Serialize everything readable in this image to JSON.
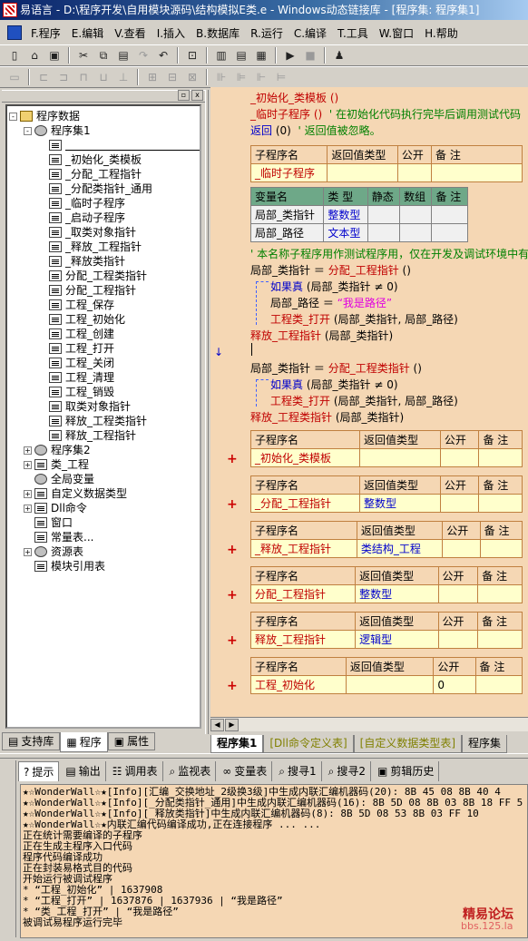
{
  "window": {
    "title": "易语言 - D:\\程序开发\\自用模块源码\\结构模拟E类.e - Windows动态链接库 - [程序集: 程序集1]"
  },
  "menu": {
    "items": [
      "F.程序",
      "E.编辑",
      "V.查看",
      "I.插入",
      "B.数据库",
      "R.运行",
      "C.编译",
      "T.工具",
      "W.窗口",
      "H.帮助"
    ]
  },
  "toolbar1": {
    "icons": [
      "new-icon",
      "open-icon",
      "save-icon",
      "cut-icon",
      "copy-icon",
      "paste-icon",
      "redo-icon",
      "undo-icon",
      "find-icon",
      "layout1-icon",
      "layout2-icon",
      "layout3-icon",
      "run-icon",
      "stop-icon",
      "debug-icon"
    ]
  },
  "left": {
    "tree": [
      {
        "label": "程序数据",
        "indent": 0,
        "pm": "-",
        "icon": "folder"
      },
      {
        "label": "程序集1",
        "indent": 1,
        "pm": "-",
        "icon": "gear"
      },
      {
        "label": "",
        "indent": 2,
        "pm": "",
        "icon": "doc",
        "underline": true
      },
      {
        "label": "_初始化_类模板",
        "indent": 2,
        "pm": "",
        "icon": "doc"
      },
      {
        "label": "_分配_工程指针",
        "indent": 2,
        "pm": "",
        "icon": "doc"
      },
      {
        "label": "_分配类指针_通用",
        "indent": 2,
        "pm": "",
        "icon": "doc"
      },
      {
        "label": "_临时子程序",
        "indent": 2,
        "pm": "",
        "icon": "doc"
      },
      {
        "label": "_启动子程序",
        "indent": 2,
        "pm": "",
        "icon": "doc"
      },
      {
        "label": "_取类对象指针",
        "indent": 2,
        "pm": "",
        "icon": "doc"
      },
      {
        "label": "_释放_工程指针",
        "indent": 2,
        "pm": "",
        "icon": "doc"
      },
      {
        "label": "_释放类指针",
        "indent": 2,
        "pm": "",
        "icon": "doc"
      },
      {
        "label": "分配_工程类指针",
        "indent": 2,
        "pm": "",
        "icon": "doc"
      },
      {
        "label": "分配_工程指针",
        "indent": 2,
        "pm": "",
        "icon": "doc"
      },
      {
        "label": "工程_保存",
        "indent": 2,
        "pm": "",
        "icon": "doc"
      },
      {
        "label": "工程_初始化",
        "indent": 2,
        "pm": "",
        "icon": "doc"
      },
      {
        "label": "工程_创建",
        "indent": 2,
        "pm": "",
        "icon": "doc"
      },
      {
        "label": "工程_打开",
        "indent": 2,
        "pm": "",
        "icon": "doc"
      },
      {
        "label": "工程_关闭",
        "indent": 2,
        "pm": "",
        "icon": "doc"
      },
      {
        "label": "工程_清理",
        "indent": 2,
        "pm": "",
        "icon": "doc"
      },
      {
        "label": "工程_销毁",
        "indent": 2,
        "pm": "",
        "icon": "doc"
      },
      {
        "label": "取类对象指针",
        "indent": 2,
        "pm": "",
        "icon": "doc"
      },
      {
        "label": "释放_工程类指针",
        "indent": 2,
        "pm": "",
        "icon": "doc"
      },
      {
        "label": "释放_工程指针",
        "indent": 2,
        "pm": "",
        "icon": "doc"
      },
      {
        "label": "程序集2",
        "indent": 1,
        "pm": "+",
        "icon": "gear"
      },
      {
        "label": "类_工程",
        "indent": 1,
        "pm": "+",
        "icon": "doc"
      },
      {
        "label": "全局变量",
        "indent": 1,
        "pm": "",
        "icon": "gear"
      },
      {
        "label": "自定义数据类型",
        "indent": 1,
        "pm": "+",
        "icon": "doc"
      },
      {
        "label": "Dll命令",
        "indent": 1,
        "pm": "+",
        "icon": "doc"
      },
      {
        "label": "窗口",
        "indent": 1,
        "pm": "",
        "icon": "doc"
      },
      {
        "label": "常量表...",
        "indent": 1,
        "pm": "",
        "icon": "doc"
      },
      {
        "label": "资源表",
        "indent": 1,
        "pm": "+",
        "icon": "gear"
      },
      {
        "label": "模块引用表",
        "indent": 1,
        "pm": "",
        "icon": "doc"
      }
    ],
    "tabs": [
      "支持库",
      "程序",
      "属性"
    ]
  },
  "code": {
    "line1": "_初始化_类模板 ()",
    "line2a": "_临时子程序 ()",
    "line2b": "' 在初始化代码执行完毕后调用测试代码",
    "line3a": "返回",
    "line3b": "(0)",
    "line3c": "' 返回值被忽略。",
    "t1": {
      "h": [
        "子程序名",
        "返回值类型",
        "公开",
        "备 注"
      ],
      "name": "_临时子程序"
    },
    "vars": {
      "h": [
        "变量名",
        "类 型",
        "静态",
        "数组",
        "备 注"
      ],
      "rows": [
        [
          "局部_类指针",
          "整数型"
        ],
        [
          "局部_路径",
          "文本型"
        ]
      ]
    },
    "comment": "' 本名称子程序用作测试程序用，仅在开发及调试环境中有效",
    "s1": {
      "lhs": "局部_类指针",
      "op": "＝",
      "fn": "分配_工程指针",
      "args": "()"
    },
    "s2": {
      "kw": "如果真",
      "cond": "(局部_类指针 ≠ 0)"
    },
    "s3": {
      "lhs": "局部_路径",
      "op": "＝",
      "str": "“我是路径”"
    },
    "s4": {
      "fn": "工程类_打开",
      "args": "(局部_类指针, 局部_路径)"
    },
    "s5": {
      "fn": "释放_工程指针",
      "args": "(局部_类指针)"
    },
    "s6": {
      "lhs": "局部_类指针",
      "op": "＝",
      "fn": "分配_工程类指针",
      "args": "()"
    },
    "s7": {
      "kw": "如果真",
      "cond": "(局部_类指针 ≠ 0)"
    },
    "s8": {
      "fn": "工程类_打开",
      "args": "(局部_类指针, 局部_路径)"
    },
    "s9": {
      "fn": "释放_工程类指针",
      "args": "(局部_类指针)"
    },
    "subs": [
      {
        "name": "_初始化_类模板",
        "ret": "",
        "cell": ""
      },
      {
        "name": "_分配_工程指针",
        "ret": "整数型",
        "cell": ""
      },
      {
        "name": "_释放_工程指针",
        "ret": "类结构_工程",
        "cell": ""
      },
      {
        "name": "分配_工程指针",
        "ret": "整数型",
        "cell": ""
      },
      {
        "name": "释放_工程指针",
        "ret": "逻辑型",
        "cell": ""
      },
      {
        "name": "工程_初始化",
        "ret": "",
        "cell": "0"
      }
    ],
    "sub_hdr": [
      "子程序名",
      "返回值类型",
      "公开",
      "备 注"
    ]
  },
  "code_tabs": [
    "程序集1",
    "[Dll命令定义表]",
    "[自定义数据类型表]",
    "程序集"
  ],
  "bottom_tabs": [
    {
      "label": "提示",
      "icon": "hint-icon"
    },
    {
      "label": "输出",
      "icon": "output-icon"
    },
    {
      "label": "调用表",
      "icon": "calltable-icon"
    },
    {
      "label": "监视表",
      "icon": "watch-icon"
    },
    {
      "label": "变量表",
      "icon": "vars-icon"
    },
    {
      "label": "搜寻1",
      "icon": "search-icon"
    },
    {
      "label": "搜寻2",
      "icon": "search-icon"
    },
    {
      "label": "剪辑历史",
      "icon": "clip-icon"
    }
  ],
  "output": [
    "★☆WonderWall☆★[Info][汇编_交换地址_2级换3级]中生成内联汇编机器码(20): 8B 45 08 8B 40 4",
    "★☆WonderWall☆★[Info][_分配类指针_通用]中生成内联汇编机器码(16): 8B 5D 08 8B 03 8B 18 FF 5",
    "★☆WonderWall☆★[Info][_释放类指针]中生成内联汇编机器码(8): 8B 5D 08 53 8B 03 FF 10",
    "★☆WonderWall☆★内联汇编代码编译成功,正在连接程序 ... ...",
    "正在统计需要编译的子程序",
    "正在生成主程序入口代码",
    "程序代码编译成功",
    "正在封装易格式目的代码",
    "开始运行被调试程序",
    "* “工程_初始化” | 1637908",
    "* “工程_打开” | 1637876 | 1637936 | “我是路径”",
    "* “类_工程_打开” | “我是路径”",
    "被调试易程序运行完毕"
  ],
  "watermark": {
    "line1": "精易论坛",
    "line2": "bbs.125.la"
  }
}
